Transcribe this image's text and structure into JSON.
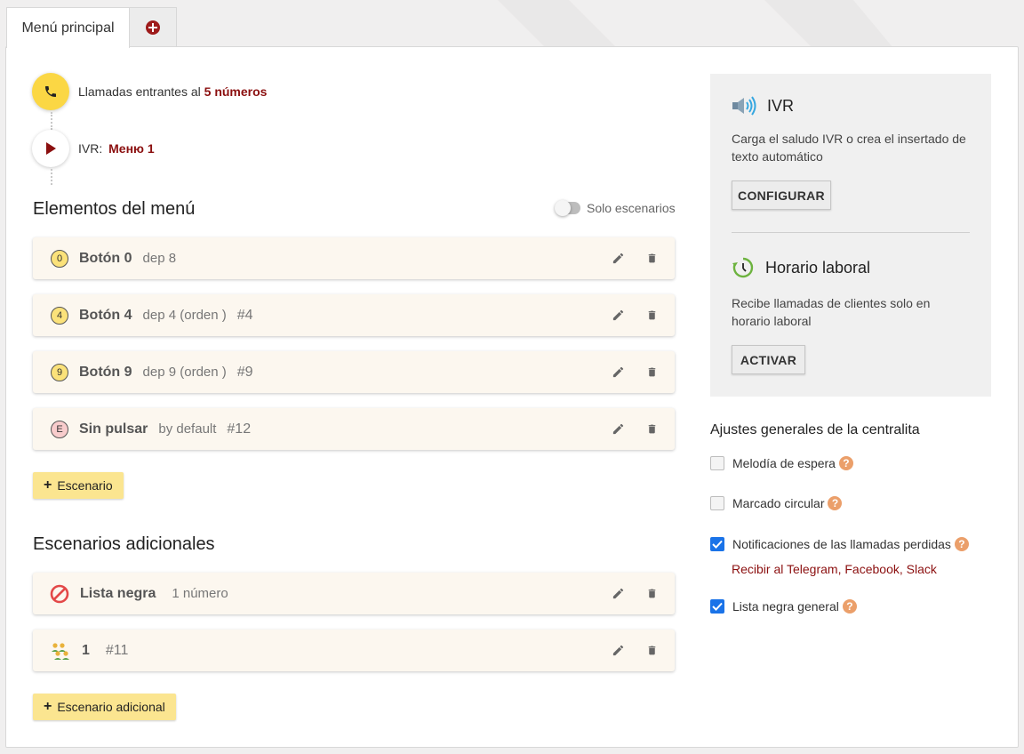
{
  "tabs": {
    "main": "Menú principal"
  },
  "flow": {
    "incoming_prefix": "Llamadas entrantes al",
    "incoming_link": "5 números",
    "ivr_prefix": "IVR:",
    "ivr_link": "Меню 1"
  },
  "menu": {
    "title": "Elementos del menú",
    "toggle_label": "Solo escenarios",
    "items": [
      {
        "badge": "0",
        "name": "Botón 0",
        "desc": "dep 8",
        "hash": ""
      },
      {
        "badge": "4",
        "name": "Botón 4",
        "desc": "dep 4 (orden )",
        "hash": "#4"
      },
      {
        "badge": "9",
        "name": "Botón 9",
        "desc": "dep 9 (orden )",
        "hash": "#9"
      },
      {
        "badge": "E",
        "name": "Sin pulsar",
        "desc": "by default",
        "hash": "#12"
      }
    ],
    "add_label": "Escenario"
  },
  "extra": {
    "title": "Escenarios adicionales",
    "items": [
      {
        "name": "Lista negra",
        "desc": "1 número",
        "hash": ""
      },
      {
        "name": "1",
        "desc": "",
        "hash": "#11"
      }
    ],
    "add_label": "Escenario adicional"
  },
  "ivr_box": {
    "title": "IVR",
    "text": "Carga el saludo IVR o crea el insertado de texto automático",
    "button": "CONFIGURAR"
  },
  "hours_box": {
    "title": "Horario laboral",
    "text": "Recibe llamadas de clientes solo en horario laboral",
    "button": "ACTIVAR"
  },
  "settings": {
    "title": "Ajustes generales de la centralita",
    "items": [
      {
        "label": "Melodía de espera",
        "checked": false
      },
      {
        "label": "Marcado circular",
        "checked": false
      },
      {
        "label": "Notificaciones de las llamadas perdidas",
        "checked": true
      },
      {
        "label": "Lista negra general",
        "checked": true
      }
    ],
    "notify_prefix": "Recibir al",
    "notify_links": [
      "Telegram",
      "Facebook",
      "Slack"
    ]
  },
  "colors": {
    "accent_red": "#8b0f0f",
    "yellow": "#fbd744",
    "check_blue": "#1a73e8",
    "help_orange": "#eb9f6a"
  }
}
